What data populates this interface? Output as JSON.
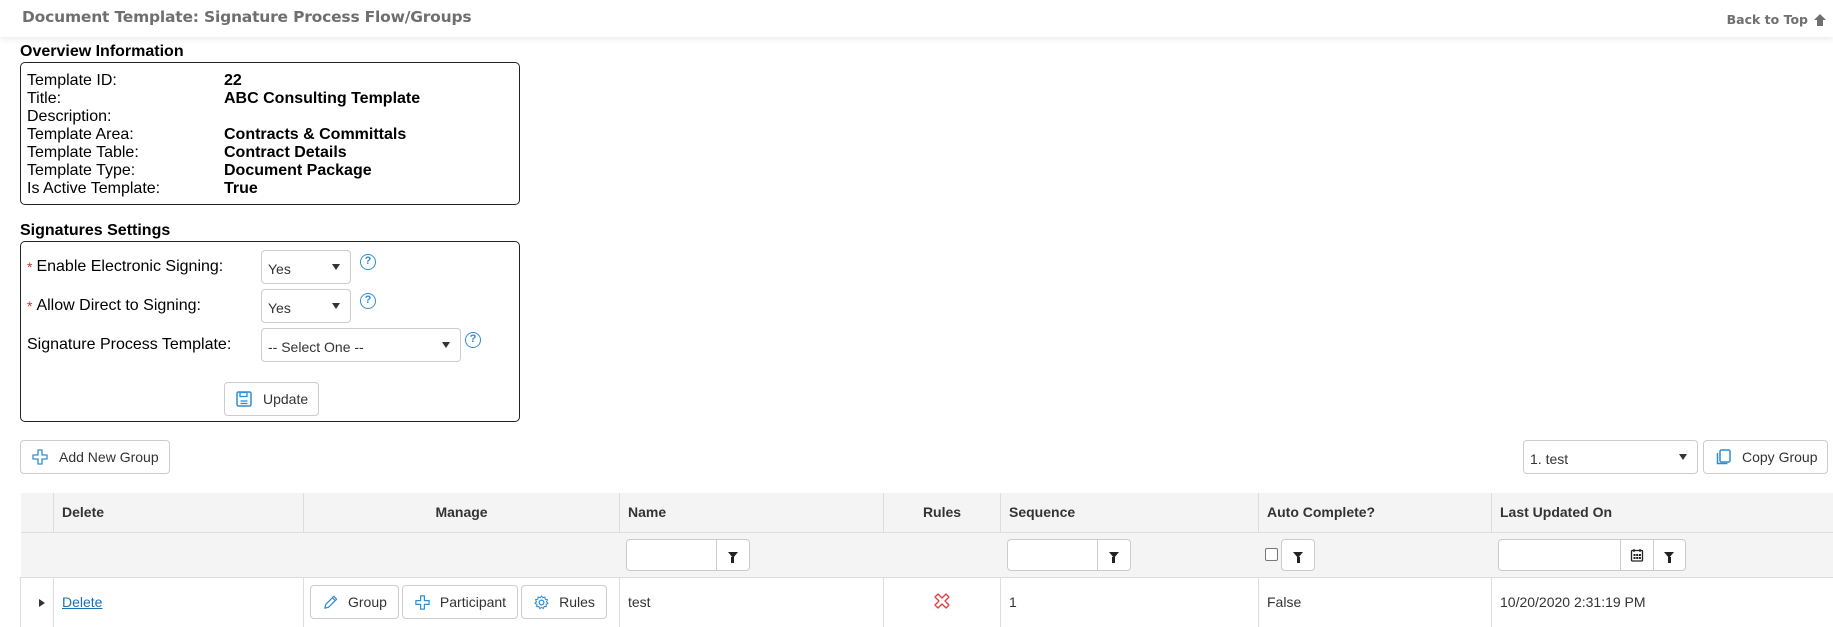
{
  "header": {
    "title": "Document Template: Signature Process Flow/Groups",
    "back_to_top": "Back to Top"
  },
  "overview": {
    "section_title": "Overview Information",
    "fields": [
      {
        "label": "Template ID:",
        "value": "22"
      },
      {
        "label": "Title:",
        "value": "ABC Consulting Template"
      },
      {
        "label": "Description:",
        "value": ""
      },
      {
        "label": "Template Area:",
        "value": "Contracts & Committals"
      },
      {
        "label": "Template Table:",
        "value": "Contract Details"
      },
      {
        "label": "Template Type:",
        "value": "Document Package"
      },
      {
        "label": "Is Active Template:",
        "value": "True"
      }
    ]
  },
  "signatures": {
    "section_title": "Signatures Settings",
    "required_marker": "*",
    "enable_electronic_signing": {
      "label": "Enable Electronic Signing:",
      "value": "Yes"
    },
    "allow_direct_to_signing": {
      "label": "Allow Direct to Signing:",
      "value": "Yes"
    },
    "signature_process_template": {
      "label": "Signature Process Template:",
      "value": "-- Select One --"
    },
    "help_glyph": "?",
    "update_label": "Update"
  },
  "toolbar": {
    "add_new_group_label": "Add New Group",
    "group_select_value": "1. test",
    "copy_group_label": "Copy Group"
  },
  "grid": {
    "columns": [
      "Delete",
      "Manage",
      "Name",
      "Rules",
      "Sequence",
      "Auto Complete?",
      "Last Updated On"
    ],
    "rows": [
      {
        "delete_label": "Delete",
        "manage_buttons": [
          "Group",
          "Participant",
          "Rules"
        ],
        "name": "test",
        "rules_icon": "x-icon",
        "sequence": "1",
        "auto_complete": "False",
        "last_updated_on": "10/20/2020 2:31:19 PM"
      }
    ]
  },
  "colors": {
    "accent_blue": "#2f8ed0",
    "link_blue": "#1f6fb5",
    "error_red": "#e03a3a",
    "header_gray": "#6f6f6f"
  }
}
